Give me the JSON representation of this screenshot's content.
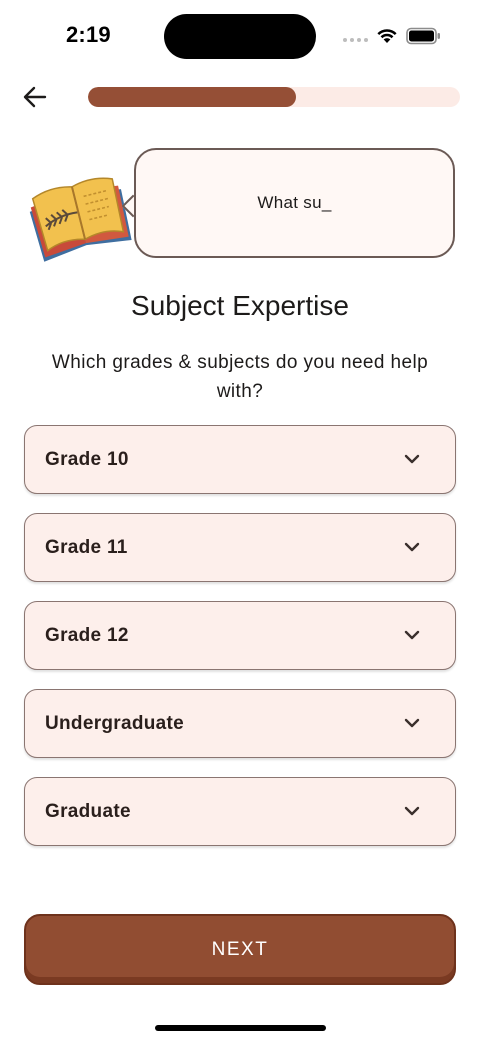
{
  "status_bar": {
    "time": "2:19"
  },
  "header": {
    "progress_fraction": 0.56,
    "accent_color": "#954f36",
    "track_color": "#fcebe6"
  },
  "mascot": {
    "icon": "open-book-icon",
    "speech_text": "What su_"
  },
  "main": {
    "title": "Subject Expertise",
    "subtitle": "Which grades & subjects do you need help with?",
    "grades": [
      {
        "label": "Grade 10"
      },
      {
        "label": "Grade 11"
      },
      {
        "label": "Grade 12"
      },
      {
        "label": "Undergraduate"
      },
      {
        "label": "Graduate"
      }
    ]
  },
  "footer": {
    "next_label": "NEXT",
    "button_color": "#914d32"
  }
}
